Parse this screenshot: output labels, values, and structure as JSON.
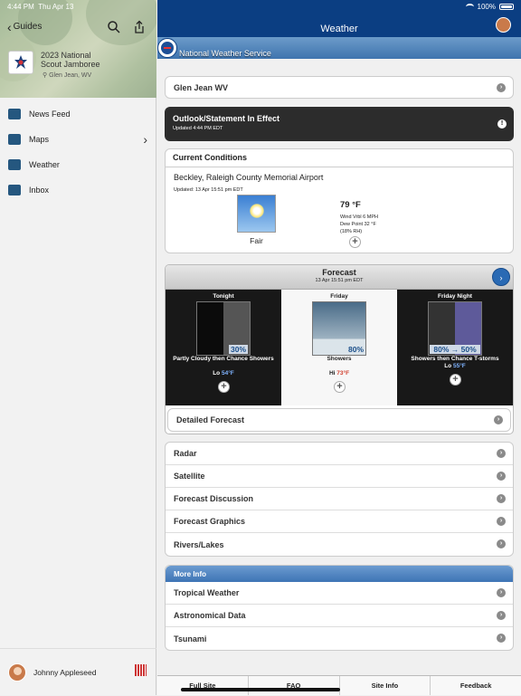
{
  "status": {
    "time": "4:44 PM",
    "date": "Thu Apr 13",
    "battery": "100%"
  },
  "sidebar": {
    "back_label": "Guides",
    "org_name_line1": "2023 National",
    "org_name_line2": "Scout Jamboree",
    "location": "Glen Jean, WV",
    "items": [
      {
        "label": "News Feed",
        "icon": "news-icon"
      },
      {
        "label": "Maps",
        "icon": "map-icon"
      },
      {
        "label": "Weather",
        "icon": "weather-icon"
      },
      {
        "label": "Inbox",
        "icon": "chat-icon"
      }
    ],
    "user_name": "Johnny Appleseed"
  },
  "header": {
    "title": "Weather",
    "brand": "National Weather Service"
  },
  "location_button": "Glen Jean WV",
  "outlook": {
    "title": "Outlook/Statement In Effect",
    "updated": "Updated 4:44 PM EDT"
  },
  "current": {
    "heading": "Current Conditions",
    "station": "Beckley, Raleigh County Memorial Airport",
    "updated": "Updated: 13 Apr 15:51 pm EDT",
    "condition": "Fair",
    "temp": "79 °F",
    "wind": "Wind Vrbl 6 MPH",
    "dewpoint": "Dew Point 32 °F",
    "rh": "(18% RH)"
  },
  "forecast": {
    "heading": "Forecast",
    "date": "13 Apr 15:51 pm EDT",
    "days": [
      {
        "name": "Tonight",
        "pct": "30%",
        "desc": "Partly Cloudy then Chance Showers",
        "temp_label": "Lo",
        "temp": "54°F"
      },
      {
        "name": "Friday",
        "pct": "80%",
        "desc": "Showers",
        "temp_label": "Hi",
        "temp": "73°F"
      },
      {
        "name": "Friday Night",
        "pct": "80% → 50%",
        "desc": "Showers then Chance T-storms",
        "temp_label": "Lo",
        "temp": "55°F"
      }
    ],
    "detailed": "Detailed Forecast"
  },
  "links": [
    "Radar",
    "Satellite",
    "Forecast Discussion",
    "Forecast Graphics",
    "Rivers/Lakes"
  ],
  "more_info": {
    "heading": "More Info",
    "items": [
      "Tropical Weather",
      "Astronomical Data",
      "Tsunami"
    ]
  },
  "footer": [
    "Full Site",
    "FAQ",
    "Site Info",
    "Feedback"
  ]
}
